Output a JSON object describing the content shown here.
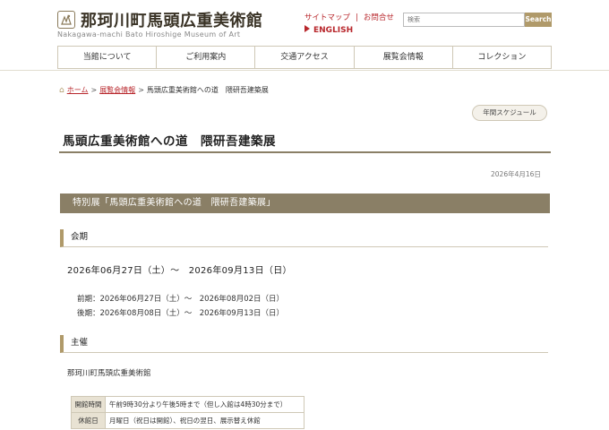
{
  "header": {
    "site_title": "那珂川町馬頭広重美術館",
    "site_subtitle": "Nakagawa-machi Bato Hiroshige Museum of Art",
    "links": [
      "サイトマップ",
      "お問合せ"
    ],
    "english_link": "ENGLISH",
    "search_placeholder": "検索",
    "search_button": "Search",
    "accent_color": "#b8272c"
  },
  "nav": {
    "items": [
      "当館について",
      "ご利用案内",
      "交通アクセス",
      "展覧会情報",
      "コレクション"
    ]
  },
  "breadcrumb": {
    "home": "ホーム",
    "section": "展覧会情報",
    "current": "馬頭広重美術館への道　隈研吾建築展"
  },
  "schedule_button": "年間スケジュール",
  "page_title": "馬頭広重美術館への道　隈研吾建築展",
  "date": "2026年4月16日",
  "banner": "特別展「馬頭広重美術館への道　隈研吾建築展」",
  "period": {
    "heading": "会期",
    "main": "2026年06月27日（土）～　2026年09月13日（日）",
    "first": "前期：2026年06月27日（土）～　2026年08月02日（日）",
    "second": "後期：2026年08月08日（土）～　2026年09月13日（日）"
  },
  "organizer": {
    "heading": "主催",
    "name": "那珂川町馬頭広重美術館"
  },
  "info_table": {
    "rows": [
      {
        "label": "開館時間",
        "value": "午前9時30分より午後5時まで（但し入館は4時30分まで）"
      },
      {
        "label": "休館日",
        "value": "月曜日（祝日は開館）、祝日の翌日、展示替え休館"
      }
    ]
  }
}
